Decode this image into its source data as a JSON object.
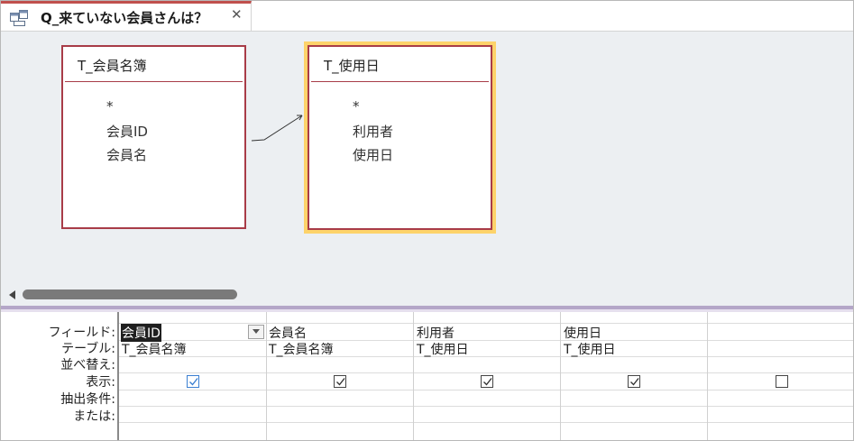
{
  "tab": {
    "title": "Q_来ていない会員さんは？",
    "close_label": "✕",
    "icon": "query-design-icon"
  },
  "tables": [
    {
      "name": "T_会員名簿",
      "fields": [
        "*",
        "会員ID",
        "会員名"
      ],
      "selected": false
    },
    {
      "name": "T_使用日",
      "fields": [
        "*",
        "利用者",
        "使用日"
      ],
      "selected": true
    }
  ],
  "grid": {
    "row_labels": [
      "フィールド:",
      "テーブル:",
      "並べ替え:",
      "表示:",
      "抽出条件:",
      "または:"
    ],
    "columns": [
      {
        "field": "会員ID",
        "table": "T_会員名簿",
        "show": true,
        "active": true
      },
      {
        "field": "会員名",
        "table": "T_会員名簿",
        "show": true,
        "active": false
      },
      {
        "field": "利用者",
        "table": "T_使用日",
        "show": true,
        "active": false
      },
      {
        "field": "使用日",
        "table": "T_使用日",
        "show": true,
        "active": false
      },
      {
        "field": "",
        "table": "",
        "show": false,
        "active": false
      }
    ]
  },
  "colors": {
    "table_border": "#a83c48",
    "selected_outline": "#fdd36a",
    "canvas_bg": "#eceff2",
    "tab_accent": "#c0504d"
  }
}
